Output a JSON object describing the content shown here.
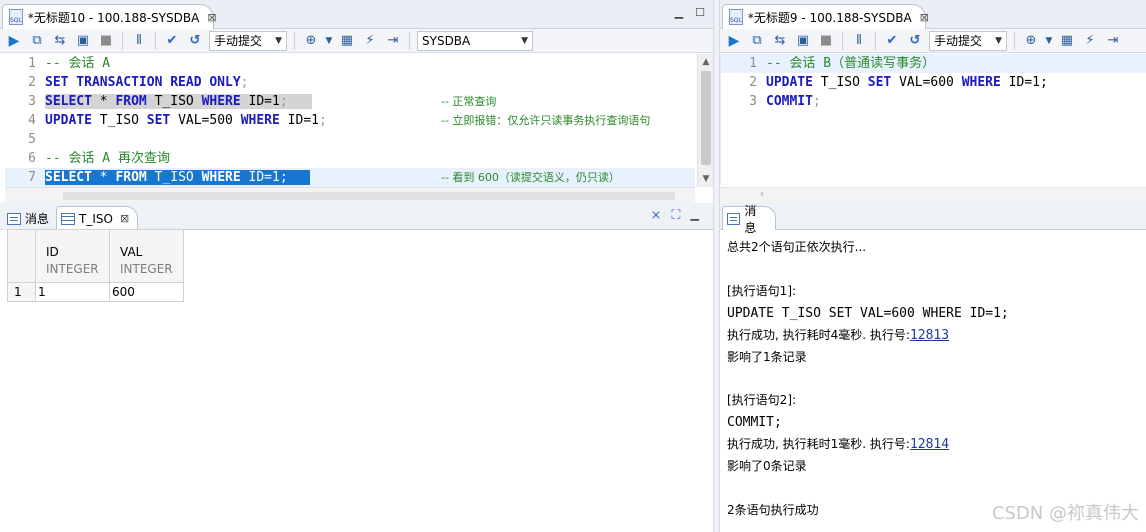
{
  "left_tab": {
    "icon": "sql-file-icon",
    "title": "*无标题10 - 100.188-SYSDBA",
    "close": "⊠"
  },
  "right_tab": {
    "icon": "sql-file-icon",
    "title": "*无标题9 - 100.188-SYSDBA",
    "close": "⊠"
  },
  "toolbar": {
    "commit_mode": "手动提交",
    "schema": "SYSDBA"
  },
  "left_editor": {
    "lines": [
      {
        "n": "1",
        "comment": "-- 会话 A"
      },
      {
        "n": "2",
        "kw1": "SET TRANSACTION READ ONLY",
        "semi": ";"
      },
      {
        "n": "3",
        "a": "SELECT",
        "b": " * ",
        "c": "FROM",
        "d": " T_ISO ",
        "e": "WHERE",
        "f": " ID=1",
        "g": ";",
        "comment": "-- 正常查询"
      },
      {
        "n": "4",
        "a": "UPDATE",
        "b": " T_ISO ",
        "c": "SET",
        "d": " VAL=500 ",
        "e": "WHERE",
        "f": " ID=1",
        "g": ";",
        "comment": "-- 立即报错：仅允许只读事务执行查询语句"
      },
      {
        "n": "5"
      },
      {
        "n": "6",
        "comment": "-- 会话 A 再次查询"
      },
      {
        "n": "7",
        "a": "SELECT",
        "b": " * ",
        "c": "FROM",
        "d": " T_ISO ",
        "e": "WHERE",
        "f": " ID=1",
        "g": ";",
        "comment": "-- 看到 600（读提交语义，仍只读）"
      }
    ]
  },
  "right_editor": {
    "lines": [
      {
        "n": "1",
        "comment": "-- 会话 B（普通读写事务）"
      },
      {
        "n": "2",
        "a": "UPDATE",
        "b": " T_ISO ",
        "c": "SET",
        "d": " VAL=600 ",
        "e": "WHERE",
        "f": " ID=1",
        "g": ";"
      },
      {
        "n": "3",
        "a": "COMMIT",
        "g": ";"
      }
    ]
  },
  "left_results": {
    "tabs": [
      "消息",
      "T_ISO"
    ],
    "columns": [
      {
        "name": "ID",
        "type": "INTEGER"
      },
      {
        "name": "VAL",
        "type": "INTEGER"
      }
    ],
    "rows": [
      {
        "rn": "1",
        "id": "1",
        "val": "600"
      }
    ]
  },
  "right_messages": {
    "tab": "消息",
    "l1": "总共2个语句正依次执行...",
    "s1_head": "[执行语句1]:",
    "s1_sql": "UPDATE T_ISO SET VAL=600 WHERE ID=1;",
    "s1_info": "执行成功, 执行耗时4毫秒. 执行号:",
    "s1_no": "12813",
    "s1_rows": "影响了1条记录",
    "s2_head": "[执行语句2]:",
    "s2_sql": "COMMIT;",
    "s2_info": "执行成功, 执行耗时1毫秒. 执行号:",
    "s2_no": "12814",
    "s2_rows": "影响了0条记录",
    "summary": "2条语句执行成功"
  },
  "watermark": "CSDN @祢真伟大"
}
